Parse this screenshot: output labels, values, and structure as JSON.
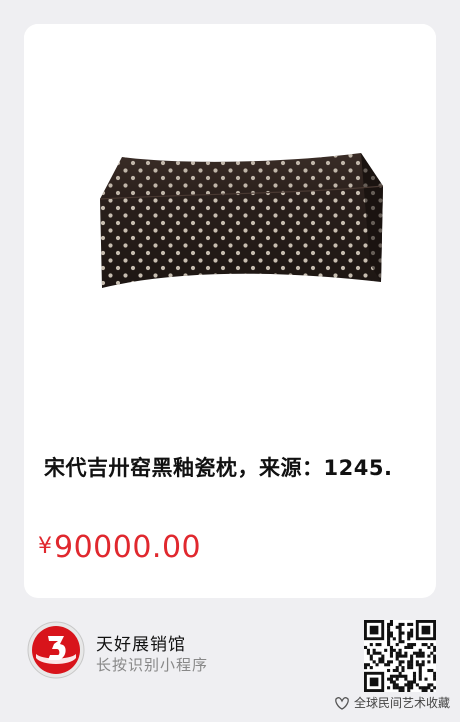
{
  "product": {
    "image_icon": "black-glazed-porcelain-pillow-photo",
    "title": "宋代吉卅窑黑釉瓷枕，来源：1245.",
    "currency_symbol": "¥",
    "price": "90000.00",
    "price_color": "#e0282e"
  },
  "store": {
    "logo_icon": "red-number-3-logo",
    "name": "天好展销馆",
    "hint": "长按识别小程序",
    "qr_icon": "qr-code-icon"
  },
  "watermark": {
    "icon": "wechat-channel-icon",
    "text": "全球民间艺术收藏"
  }
}
